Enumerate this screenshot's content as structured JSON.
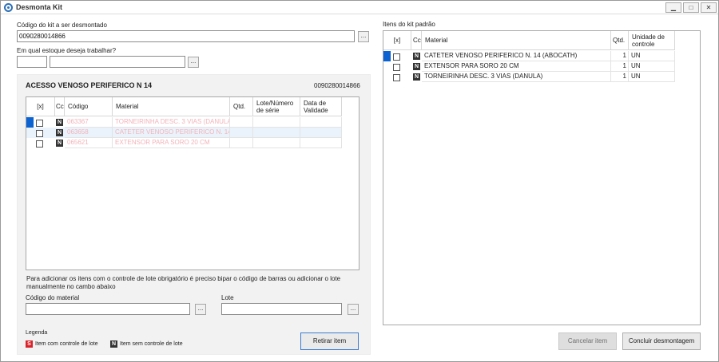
{
  "window": {
    "title": "Desmonta Kit",
    "controls": [
      "▁",
      "□",
      "✕"
    ]
  },
  "form": {
    "kit_code_label": "Código do kit a ser desmontado",
    "kit_code_value": "0090280014866",
    "stock_label": "Em qual estoque deseja trabalhar?",
    "stock_code": "",
    "stock_name": "",
    "lookup_label": "..."
  },
  "kit": {
    "name": "ACESSO VENOSO PERIFERICO N 14",
    "code": "0090280014866"
  },
  "left_grid": {
    "headers": [
      "[x]",
      "Cc",
      "Código",
      "Material",
      "Qtd.",
      "Lote/Número de série",
      "Data de Validade"
    ],
    "rows": [
      {
        "badge": "N",
        "code": "063367",
        "material": "TORNEIRINHA DESC. 3 VIAS (DANULA)",
        "qty": "",
        "lot": "",
        "validity": ""
      },
      {
        "badge": "N",
        "code": "063658",
        "material": "CATETER VENOSO PERIFERICO N. 14",
        "qty": "",
        "lot": "",
        "validity": ""
      },
      {
        "badge": "N",
        "code": "065621",
        "material": "EXTENSOR PARA SORO 20 CM",
        "qty": "",
        "lot": "",
        "validity": ""
      }
    ]
  },
  "hint": "Para adicionar os itens com o controle de lote obrigatório é preciso bipar o código de barras ou adicionar o lote manualmente no cambo abaixo",
  "fields": {
    "material_label": "Código do material",
    "lote_label": "Lote",
    "material_value": "",
    "lote_value": ""
  },
  "legend": {
    "title": "Legenda",
    "s_badge": "S",
    "s_text": "Item com controle de lote",
    "n_badge": "N",
    "n_text": "Item sem controle de lote"
  },
  "buttons": {
    "retirar": "Retirar item",
    "cancelar": "Cancelar item",
    "concluir": "Concluir desmontagem"
  },
  "right_panel": {
    "label": "Itens do kit padrão",
    "headers": [
      "[x]",
      "Cc",
      "Material",
      "Qtd.",
      "Unidade de controle"
    ],
    "rows": [
      {
        "badge": "N",
        "material": "CATETER VENOSO PERIFERICO N. 14 (ABOCATH)",
        "qty": "1",
        "unit": "UN"
      },
      {
        "badge": "N",
        "material": "EXTENSOR PARA SORO 20 CM",
        "qty": "1",
        "unit": "UN"
      },
      {
        "badge": "N",
        "material": "TORNEIRINHA DESC. 3 VIAS (DANULA)",
        "qty": "1",
        "unit": "UN"
      }
    ]
  },
  "colors": {
    "selection": "#0b62d0",
    "badge_s": "#d8232a",
    "badge_n": "#333333",
    "faded_text": "#f2b3ba"
  }
}
